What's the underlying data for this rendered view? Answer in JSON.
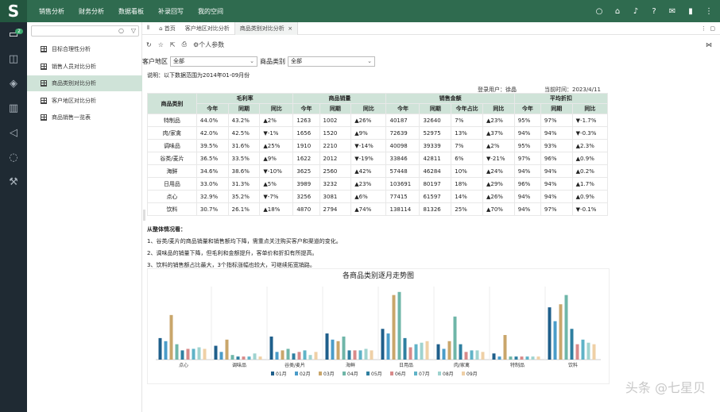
{
  "logo": "S",
  "topnav": [
    "销售分析",
    "财务分析",
    "数据看板",
    "补录回写",
    "我的空间"
  ],
  "rail_badge": "2",
  "sidebar": {
    "items": [
      "目标合理性分析",
      "销售人员对比分析",
      "商品类别对比分析",
      "客户地区对比分析",
      "商品销售一览表"
    ]
  },
  "tabs": {
    "home": "首页",
    "tab1": "客户地区对比分析",
    "tab2": "商品类别对比分析",
    "close": "×"
  },
  "toolbar": {
    "personal": "个人参数"
  },
  "filters": {
    "region_label": "客户地区",
    "region_value": "全部",
    "category_label": "商品类别",
    "category_value": "全部"
  },
  "note": "说明：以下数据范围为2014年01-09月份",
  "meta": {
    "login": "登录用户：徐晶",
    "time": "当前时间：2023/4/11"
  },
  "table": {
    "col_cat": "商品类别",
    "groups": [
      "毛利率",
      "商品销量",
      "销售金额",
      "平均折扣"
    ],
    "sub": [
      "今年",
      "同期",
      "同比",
      "今年",
      "同期",
      "同比",
      "今年",
      "同期",
      "今年占比",
      "同比",
      "今年",
      "同期",
      "同比"
    ],
    "rows": [
      [
        "特制品",
        "44.0%",
        "43.2%",
        "▲2%",
        "1263",
        "1002",
        "▲26%",
        "40187",
        "32640",
        "7%",
        "▲23%",
        "95%",
        "97%",
        "▼-1.7%"
      ],
      [
        "肉/家禽",
        "42.0%",
        "42.5%",
        "▼-1%",
        "1656",
        "1520",
        "▲9%",
        "72639",
        "52975",
        "13%",
        "▲37%",
        "94%",
        "94%",
        "▼-0.3%"
      ],
      [
        "调味品",
        "39.5%",
        "31.6%",
        "▲25%",
        "1910",
        "2210",
        "▼-14%",
        "40098",
        "39339",
        "7%",
        "▲2%",
        "95%",
        "93%",
        "▲2.3%"
      ],
      [
        "谷类/麦片",
        "36.5%",
        "33.5%",
        "▲9%",
        "1622",
        "2012",
        "▼-19%",
        "33846",
        "42811",
        "6%",
        "▼-21%",
        "97%",
        "96%",
        "▲0.9%"
      ],
      [
        "海鲜",
        "34.6%",
        "38.6%",
        "▼-10%",
        "3625",
        "2560",
        "▲42%",
        "57448",
        "46284",
        "10%",
        "▲24%",
        "94%",
        "94%",
        "▲0.2%"
      ],
      [
        "日用品",
        "33.0%",
        "31.3%",
        "▲5%",
        "3989",
        "3232",
        "▲23%",
        "103691",
        "80197",
        "18%",
        "▲29%",
        "96%",
        "94%",
        "▲1.7%"
      ],
      [
        "点心",
        "32.9%",
        "35.2%",
        "▼-7%",
        "3256",
        "3081",
        "▲6%",
        "77415",
        "61597",
        "14%",
        "▲26%",
        "94%",
        "94%",
        "▲0.9%"
      ],
      [
        "饮料",
        "30.7%",
        "26.1%",
        "▲18%",
        "4870",
        "2794",
        "▲74%",
        "138114",
        "81326",
        "25%",
        "▲70%",
        "94%",
        "97%",
        "▼-0.1%"
      ]
    ]
  },
  "summary": {
    "title": "从整体情况看：",
    "lines": [
      "1、谷类/麦片的商品销量和销售额均下降，需重点关注购买客户和渠道的变化。",
      "2、调味品的销量下降，但毛利和金额提升，客单价和折扣有所提高。",
      "3、饮料的销售额占比最大，3个指标涨幅也较大，可继续拓宽销路。"
    ]
  },
  "chart_data": {
    "type": "bar",
    "title": "各商品类别逐月走势图",
    "categories": [
      "点心",
      "调味品",
      "谷类/麦片",
      "海鲜",
      "日用品",
      "肉/家禽",
      "特制品",
      "饮料"
    ],
    "series": [
      {
        "name": "01月",
        "color": "#1f5f8b",
        "values": [
          28,
          18,
          30,
          34,
          40,
          20,
          8,
          68
        ]
      },
      {
        "name": "02月",
        "color": "#4a9cc9",
        "values": [
          24,
          10,
          10,
          26,
          34,
          14,
          4,
          50
        ]
      },
      {
        "name": "03月",
        "color": "#c9a66b",
        "values": [
          58,
          26,
          12,
          24,
          84,
          24,
          32,
          72
        ]
      },
      {
        "name": "04月",
        "color": "#6fb6a8",
        "values": [
          20,
          6,
          14,
          30,
          88,
          56,
          4,
          84
        ]
      },
      {
        "name": "05月",
        "color": "#2f7fa0",
        "values": [
          12,
          4,
          8,
          12,
          28,
          20,
          4,
          40
        ]
      },
      {
        "name": "06月",
        "color": "#d88a8a",
        "values": [
          14,
          4,
          10,
          12,
          16,
          10,
          4,
          20
        ]
      },
      {
        "name": "07月",
        "color": "#5fb3c7",
        "values": [
          14,
          4,
          12,
          12,
          20,
          12,
          4,
          26
        ]
      },
      {
        "name": "08月",
        "color": "#9fd3cf",
        "values": [
          16,
          8,
          6,
          14,
          22,
          12,
          4,
          22
        ]
      },
      {
        "name": "09月",
        "color": "#efd0a6",
        "values": [
          14,
          4,
          10,
          12,
          24,
          10,
          4,
          20
        ]
      }
    ]
  },
  "watermark": "头条 @七星贝"
}
